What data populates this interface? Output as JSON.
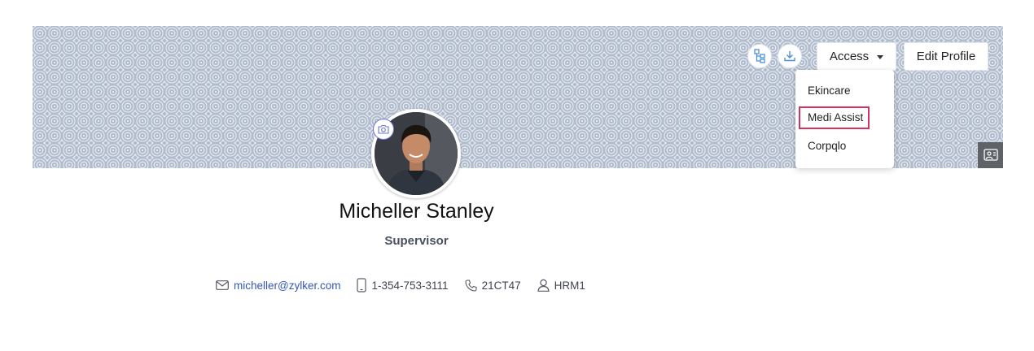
{
  "profile": {
    "name": "Micheller Stanley",
    "role": "Supervisor"
  },
  "header_actions": {
    "org_chart_icon": "org-chart-icon",
    "download_icon": "download-icon",
    "access_label": "Access",
    "edit_profile_label": "Edit Profile"
  },
  "access_menu": {
    "items": [
      "Ekincare",
      "Medi Assist",
      "Corpqlo"
    ],
    "highlighted": "Medi Assist"
  },
  "contact": {
    "email": "micheller@zylker.com",
    "mobile": "1-354-753-3111",
    "extension": "21CT47",
    "department": "HRM1"
  },
  "colors": {
    "highlight": "#d8315b",
    "link": "#3556b8",
    "banner": "#b9c4d3"
  }
}
